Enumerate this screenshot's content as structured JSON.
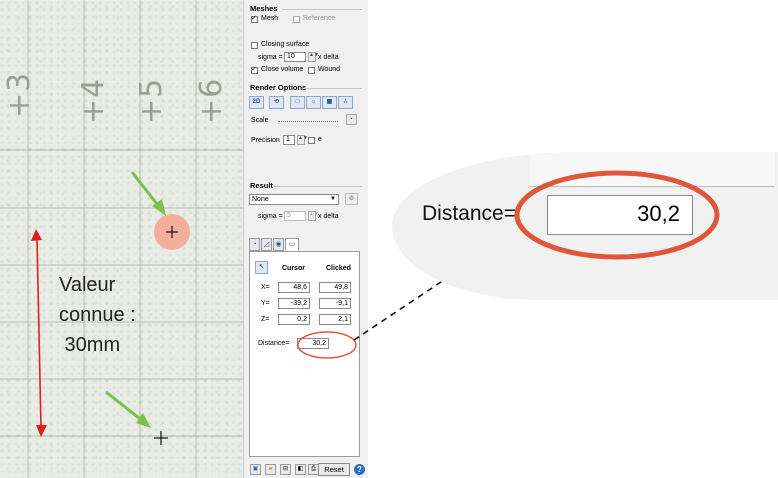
{
  "scan": {
    "tick_labels": [
      "+3",
      "+4",
      "+5",
      "+6"
    ],
    "annotation_lines": [
      "Valeur",
      "connue :",
      " 30mm"
    ]
  },
  "panel": {
    "meshes": {
      "title": "Meshes",
      "mesh_label": "Mesh",
      "reference_label": "Reference",
      "closing_surface_label": "Closing surface",
      "sigma_label": "sigma =",
      "sigma_value": "10",
      "x_delta_label": "x delta",
      "close_volume_label": "Close volume",
      "wound_label": "Wound"
    },
    "render": {
      "title": "Render Options",
      "btn_2d": "2D",
      "scale_label": "Scale",
      "precision_label": "Precision",
      "precision_value": "1",
      "e_label": "e"
    },
    "result": {
      "title": "Result",
      "selected": "None",
      "sigma_label": "sigma =",
      "sigma_value": "5",
      "x_delta_label": "x delta"
    },
    "measure": {
      "col_cursor": "Cursor",
      "col_clicked": "Clicked",
      "rows": [
        {
          "label": "X=",
          "cursor": "48,6",
          "clicked": "49,8"
        },
        {
          "label": "Y=",
          "cursor": "-39,2",
          "clicked": "-9,1"
        },
        {
          "label": "Z=",
          "cursor": "0,2",
          "clicked": "2,1"
        }
      ],
      "distance_label": "Distance=",
      "distance_value": "30,2"
    },
    "reset_label": "Reset",
    "help_label": "?"
  },
  "zoom": {
    "distance_label": "Distance=",
    "distance_value": "30,2"
  },
  "colors": {
    "highlight_ellipse": "#e0563a",
    "green_arrow": "#7cc04a",
    "red_arrow": "#e02020",
    "clicked_point": "#f4a58f"
  }
}
